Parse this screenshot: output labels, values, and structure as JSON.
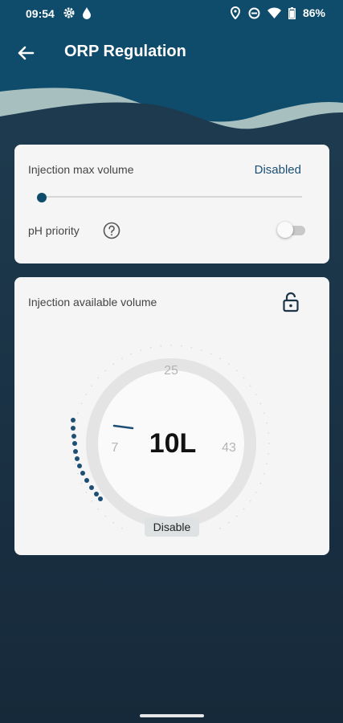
{
  "status_bar": {
    "time": "09:54",
    "battery": "86%",
    "icons": [
      "gear-icon",
      "drop-icon",
      "location-icon",
      "dnd-icon",
      "wifi-icon",
      "battery-icon"
    ]
  },
  "app_bar": {
    "title": "ORP Regulation",
    "back_icon": "arrow-left-icon"
  },
  "max_volume_card": {
    "label": "Injection max volume",
    "status_link": "Disabled",
    "slider_value": 0,
    "ph_priority_label": "pH priority",
    "ph_priority_enabled": false
  },
  "available_volume_card": {
    "label": "Injection available volume",
    "value": "10L",
    "tick_left": "7",
    "tick_top": "25",
    "tick_right": "43",
    "disable_label": "Disable",
    "locked": false
  },
  "colors": {
    "header": "#0f4c6b",
    "background": "#1d3548",
    "accent": "#1d4f74",
    "card": "#f5f5f5"
  }
}
